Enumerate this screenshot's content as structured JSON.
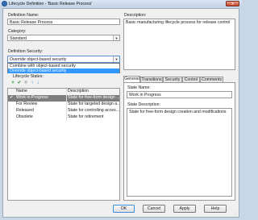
{
  "window": {
    "title": "Lifecycle Definition - 'Basic Release Process'",
    "close_label": "x"
  },
  "definition_name": {
    "label": "Definition Name:",
    "value": "Basic Release Process"
  },
  "description": {
    "label": "Description:",
    "value": "Basic manufacturing lifecycle process for release control"
  },
  "category": {
    "label": "Category:",
    "value": "Standard"
  },
  "security": {
    "label": "Definition Security:",
    "value": "Override object-based security",
    "options": [
      "Combine with object-based security",
      "Override object-based security"
    ],
    "selected_index": 1
  },
  "states": {
    "label": "Lifecycle States:",
    "toolbar": {
      "add_icon": "+",
      "check_icon": "✔",
      "delete_icon": "✖",
      "up_icon": "↑",
      "down_icon": "↓"
    },
    "columns": {
      "name": "Name",
      "description": "Description"
    },
    "rows": [
      {
        "checked": true,
        "name": "Work in Progress",
        "description": "State for free-form design ...",
        "selected": true
      },
      {
        "checked": false,
        "name": "For Review",
        "description": "State for targeted design a..."
      },
      {
        "checked": false,
        "name": "Released",
        "description": "State for controlling acces..."
      },
      {
        "checked": false,
        "name": "Obsolete",
        "description": "State for retirement"
      }
    ]
  },
  "tabs": [
    "General",
    "Transitions",
    "Security",
    "Control",
    "Comments"
  ],
  "active_tab": "General",
  "general": {
    "state_name_label": "State Name:",
    "state_name_value": "Work in Progress",
    "state_description_label": "State Description:",
    "state_description_value": "State for free-form design creation and modifications"
  },
  "buttons": {
    "ok": "OK",
    "cancel": "Cancel",
    "apply": "Apply",
    "help": "Help"
  }
}
